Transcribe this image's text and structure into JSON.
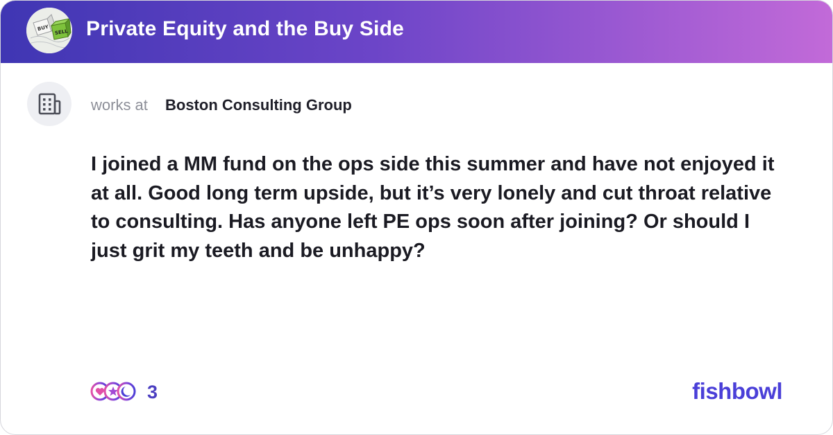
{
  "header": {
    "bowl_title": "Private Equity and the Buy Side",
    "bowl_avatar_labels": [
      "BUY",
      "SELL"
    ],
    "gradient_colors": [
      "#3f36b3",
      "#c26ad8"
    ]
  },
  "author": {
    "works_at_label": "works at",
    "company": "Boston Consulting Group",
    "avatar_icon": "building-icon"
  },
  "post": {
    "body": "I joined a MM fund on the ops side this summer and have not enjoyed it at all. Good long term upside, but it’s very lonely and cut throat relative to consulting. Has anyone left PE ops soon after joining? Or should I just grit my teeth and be unhappy?"
  },
  "footer": {
    "reaction_icons": [
      "heart-reaction-icon",
      "star-reaction-icon",
      "moon-reaction-icon"
    ],
    "reaction_count": "3",
    "brand": "fishbowl",
    "brand_color": "#4a3fd8"
  }
}
